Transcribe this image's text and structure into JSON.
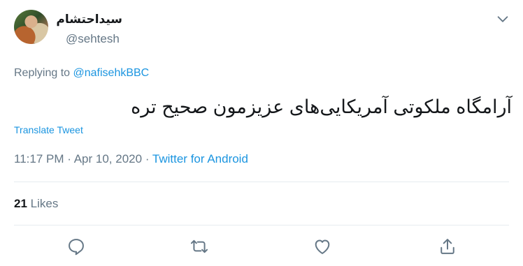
{
  "tweet": {
    "display_name": "سیداحتشام",
    "handle": "@sehtesh",
    "replying_prefix": "Replying to",
    "replying_to": "@nafisehkBBC",
    "text": "آرامگاه ملکوتی آمریکایی‌های عزیزمون صحیح تره",
    "translate_label": "Translate Tweet",
    "time": "11:17 PM",
    "date": "Apr 10, 2020",
    "separator": "·",
    "source": "Twitter for Android",
    "likes_count": "21",
    "likes_label": "Likes"
  },
  "icons": {
    "caret": "chevron-down-icon",
    "reply": "reply-icon",
    "retweet": "retweet-icon",
    "like": "heart-icon",
    "share": "share-icon"
  },
  "colors": {
    "link": "#1b95e0",
    "secondary_text": "#657786",
    "primary_text": "#14171a",
    "divider": "#e6ecf0"
  }
}
